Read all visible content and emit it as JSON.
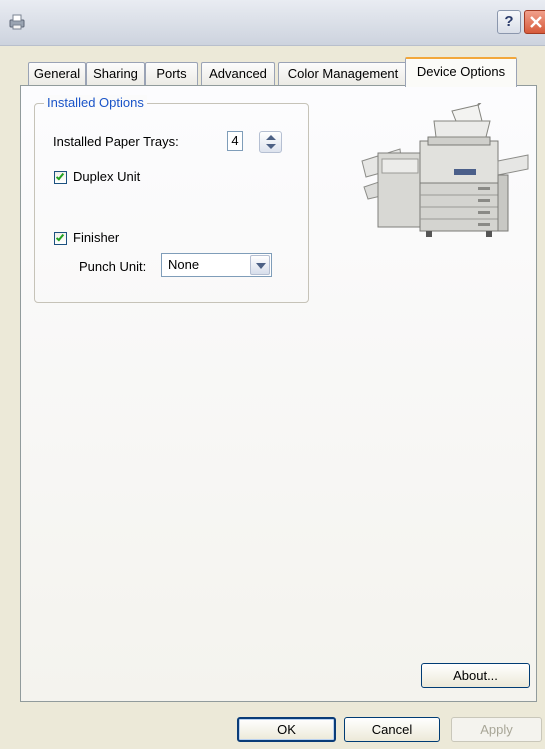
{
  "window": {
    "help_glyph": "?",
    "accent_color": "#1a54c8"
  },
  "tabs": [
    {
      "label": "General"
    },
    {
      "label": "Sharing"
    },
    {
      "label": "Ports"
    },
    {
      "label": "Advanced"
    },
    {
      "label": "Color Management"
    },
    {
      "label": "Device Options"
    }
  ],
  "installed_options": {
    "group_title": "Installed Options",
    "paper_trays_label": "Installed Paper Trays:",
    "paper_trays_value": "4",
    "duplex_label": "Duplex Unit",
    "duplex_checked": true,
    "finisher_label": "Finisher",
    "finisher_checked": true,
    "punch_unit_label": "Punch Unit:",
    "punch_unit_value": "None"
  },
  "buttons": {
    "about": "About...",
    "ok": "OK",
    "cancel": "Cancel",
    "apply": "Apply"
  }
}
